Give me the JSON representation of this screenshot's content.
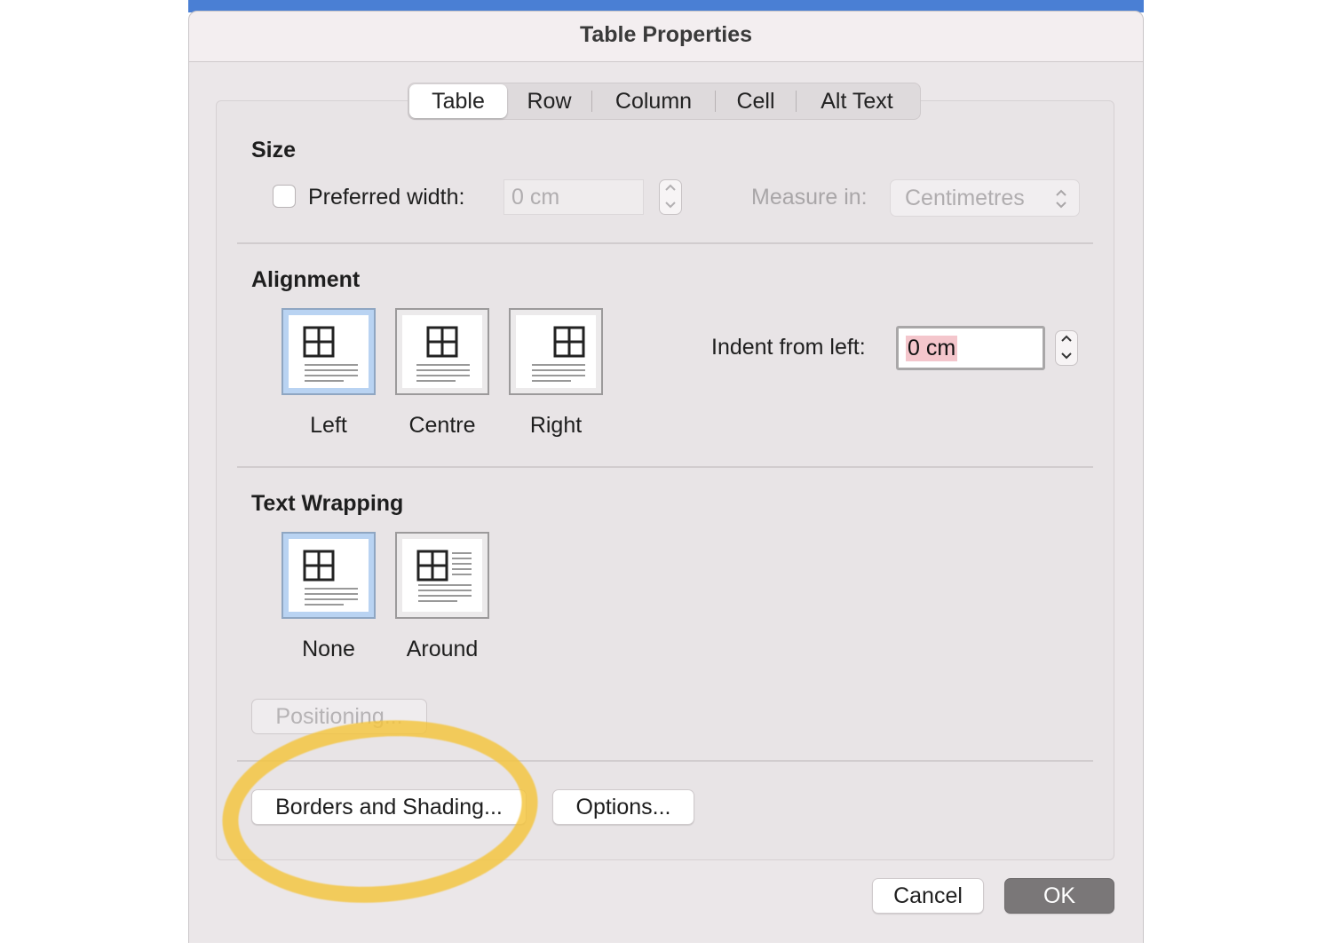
{
  "window": {
    "title": "Table Properties"
  },
  "tabs": [
    {
      "label": "Table",
      "active": true
    },
    {
      "label": "Row",
      "active": false
    },
    {
      "label": "Column",
      "active": false
    },
    {
      "label": "Cell",
      "active": false
    },
    {
      "label": "Alt Text",
      "active": false
    }
  ],
  "size": {
    "heading": "Size",
    "preferred_width_label": "Preferred width:",
    "preferred_width_checked": false,
    "preferred_width_value": "0 cm",
    "measure_in_label": "Measure in:",
    "measure_in_value": "Centimetres"
  },
  "alignment": {
    "heading": "Alignment",
    "options": [
      {
        "label": "Left",
        "selected": true
      },
      {
        "label": "Centre",
        "selected": false
      },
      {
        "label": "Right",
        "selected": false
      }
    ],
    "indent_label": "Indent from left:",
    "indent_value": "0 cm"
  },
  "text_wrapping": {
    "heading": "Text Wrapping",
    "options": [
      {
        "label": "None",
        "selected": true
      },
      {
        "label": "Around",
        "selected": false
      }
    ],
    "positioning_label": "Positioning..."
  },
  "buttons": {
    "borders_shading": "Borders and Shading...",
    "options": "Options...",
    "cancel": "Cancel",
    "ok": "OK"
  },
  "colors": {
    "highlight_marker": "#f4c43c",
    "selected_option": "#b9d3f2",
    "ok_button": "#7a7778",
    "title_bar_blue": "#4a7fd4"
  }
}
